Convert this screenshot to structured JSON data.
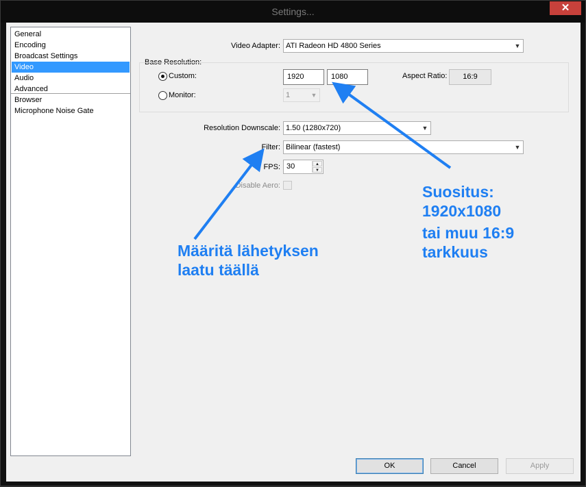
{
  "window": {
    "title": "Settings...",
    "close_glyph": "✕"
  },
  "sidebar": {
    "items": [
      {
        "label": "General"
      },
      {
        "label": "Encoding"
      },
      {
        "label": "Broadcast Settings"
      },
      {
        "label": "Video",
        "selected": true
      },
      {
        "label": "Audio"
      },
      {
        "label": "Advanced"
      },
      {
        "label": "Browser"
      },
      {
        "label": "Microphone Noise Gate"
      }
    ]
  },
  "video": {
    "adapter_label": "Video Adapter:",
    "adapter_value": "ATI Radeon HD 4800 Series",
    "base_resolution_label": "Base Resolution:",
    "custom_label": "Custom:",
    "custom_selected": true,
    "width_value": "1920",
    "height_value": "1080",
    "aspect_label": "Aspect Ratio:",
    "aspect_value": "16:9",
    "monitor_label": "Monitor:",
    "monitor_value": "1",
    "downscale_label": "Resolution Downscale:",
    "downscale_value": "1.50  (1280x720)",
    "filter_label": "Filter:",
    "filter_value": "Bilinear (fastest)",
    "fps_label": "FPS:",
    "fps_value": "30",
    "disable_aero_label": "Disable Aero:"
  },
  "buttons": {
    "ok": "OK",
    "cancel": "Cancel",
    "apply": "Apply"
  },
  "annotations": {
    "left_line1": "Määritä lähetyksen",
    "left_line2": "laatu täällä",
    "right_line1": "Suositus:",
    "right_line2": "1920x1080",
    "right_line3": "tai muu 16:9",
    "right_line4": "tarkkuus",
    "color": "#1f7ff2"
  },
  "icons": {
    "dropdown": "chevron-down-icon",
    "spin_up": "spin-up-icon",
    "spin_down": "spin-down-icon",
    "close": "close-icon"
  },
  "colors": {
    "selection": "#3399ff",
    "close_button": "#c7413b",
    "dialog_background": "#f0f0f0"
  }
}
